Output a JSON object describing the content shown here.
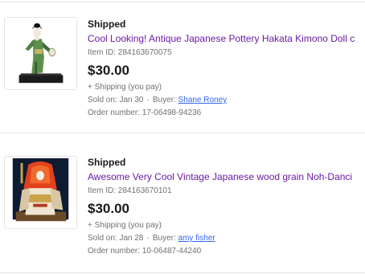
{
  "orders": [
    {
      "status": "Shipped",
      "title": "Cool Looking! Antique Japanese Pottery Hakata Kimono Doll c",
      "item_id": "Item ID: 284163670075",
      "price": "$30.00",
      "shipping": "+ Shipping (you pay)",
      "sold_on": "Sold on: Jan 30",
      "separator": "·",
      "buyer_label": "Buyer:",
      "buyer": "Shane Roney",
      "order_number": "Order number: 17-06498-94236",
      "image_icon": "kimono-doll-image"
    },
    {
      "status": "Shipped",
      "title": "Awesome Very Cool Vintage Japanese wood grain Noh-Danci",
      "item_id": "Item ID: 284163670101",
      "price": "$30.00",
      "shipping": "+ Shipping (you pay)",
      "sold_on": "Sold on: Jan 28",
      "separator": "·",
      "buyer_label": "Buyer:",
      "buyer": "amy fisher",
      "order_number": "Order number: 10-06487-44240",
      "image_icon": "noh-dancer-doll-image"
    }
  ],
  "colors": {
    "title_link": "#6b1aa3",
    "buyer_link": "#3665f3",
    "secondary_text": "#707070"
  }
}
